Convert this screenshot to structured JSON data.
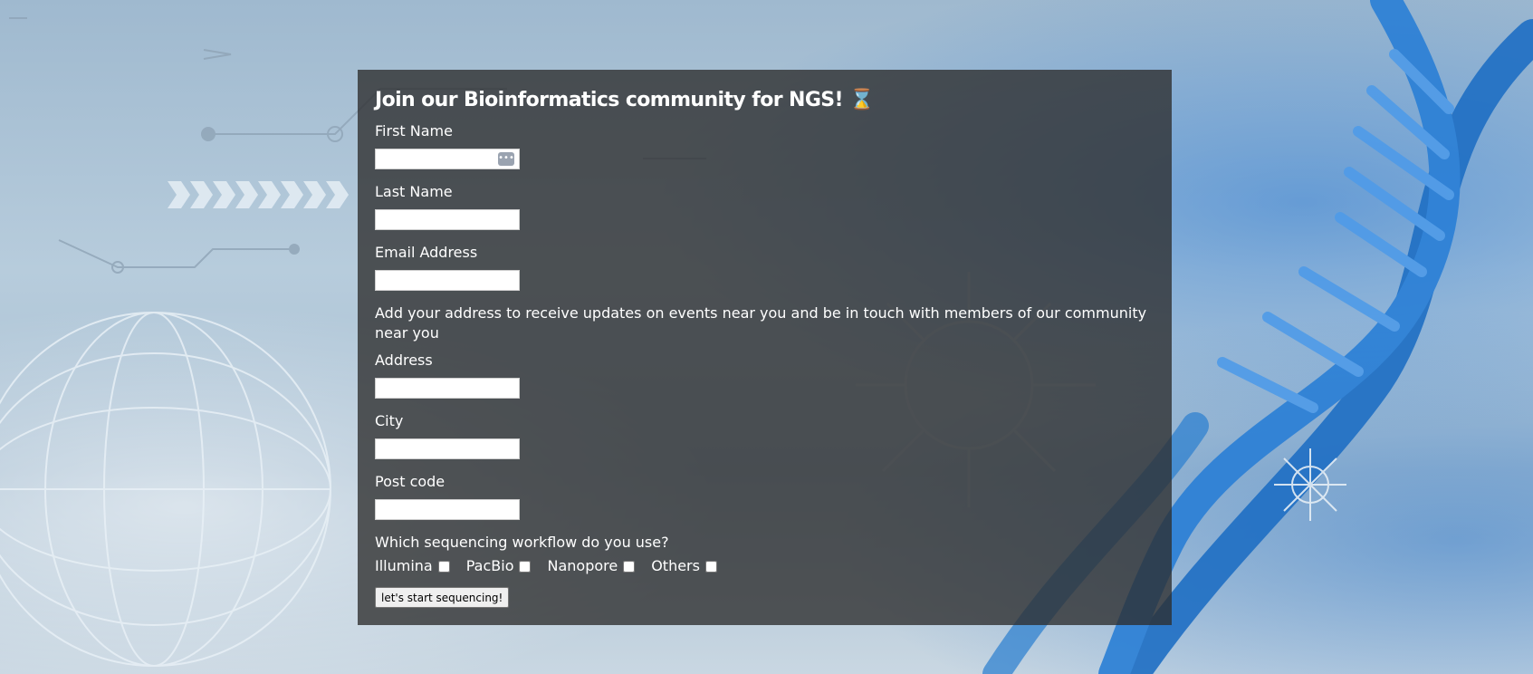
{
  "form": {
    "title": "Join our Bioinformatics community for NGS! ⌛",
    "first_name_label": "First Name",
    "first_name_value": "",
    "last_name_label": "Last Name",
    "last_name_value": "",
    "email_label": "Email Address",
    "email_value": "",
    "address_note": "Add your address to receive updates on events near you and be in touch with members of our community near you",
    "address_label": "Address",
    "address_value": "",
    "city_label": "City",
    "city_value": "",
    "postcode_label": "Post code",
    "postcode_value": "",
    "workflow_question": "Which sequencing workflow do you use?",
    "workflow_options": [
      "Illumina",
      "PacBio",
      "Nanopore",
      "Others"
    ],
    "submit_label": "let's start sequencing!"
  },
  "icons": {
    "password_manager_icon": "dots-key-icon",
    "title_icon": "hourglass-icon"
  },
  "colors": {
    "panel_background": "#2d2d2d",
    "dna_blue": "#1f6fc4",
    "text": "#ffffff"
  }
}
